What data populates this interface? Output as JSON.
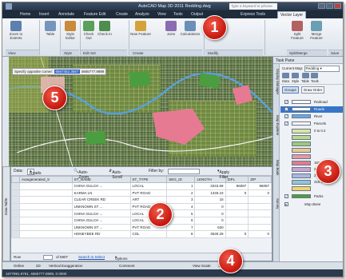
{
  "app": {
    "title": "AutoCAD Map 3D 2011    Redding.dwg",
    "search_placeholder": "Type a keyword or phrase"
  },
  "ribbon_tabs": [
    "Home",
    "Insert",
    "Annotate",
    "Feature Edit",
    "Create",
    "Analyze",
    "View",
    "Tools",
    "Output",
    "Express Tools",
    "Vector Layer"
  ],
  "ribbon": {
    "tools": [
      {
        "label": "Zoom to Extents",
        "color": "#5d7fb0"
      },
      {
        "label": "Table",
        "color": "#7794bd"
      },
      {
        "label": "Style Editor",
        "color": "#c98a3a"
      },
      {
        "label": "Check Out",
        "color": "#5aa05a"
      },
      {
        "label": "Check In",
        "color": "#4f8d4f"
      },
      {
        "label": "New Feature",
        "color": "#d3a23b"
      },
      {
        "label": "Joins",
        "color": "#8a6cb3"
      },
      {
        "label": "Calculations",
        "color": "#6b8fb9"
      },
      {
        "label": "Split Feature",
        "color": "#b36262"
      },
      {
        "label": "Merge Feature",
        "color": "#6a9fb3"
      }
    ],
    "groups": [
      "View",
      "Style",
      "Edit Set",
      "Create",
      "Modify",
      "Split/Merge",
      "Save"
    ]
  },
  "map": {
    "coord_label": "Specify opposite corner:",
    "coord_x": "6567452.3567",
    "coord_y": "4665777.8989"
  },
  "data_table": {
    "data_label": "Data:",
    "data_source": "Roads",
    "auto_zoom": "Auto-Zoom",
    "auto_scroll": "Auto-Scroll",
    "filter_by": "Filter by:",
    "apply_filter": "Apply Filter",
    "side_label": "Data Table",
    "columns": [
      "Autogenerated_S",
      "ST_NAME",
      "ST_TYPE",
      "SEG_ID",
      "LENGTH",
      "ZIPL",
      "ZIP"
    ],
    "rows": [
      [
        "",
        "CHINA GULCH ...",
        "LOCAL",
        "1",
        "3343.69",
        "96087",
        "96087"
      ],
      [
        "",
        "KARMA LN",
        "PVT ROAD",
        "2",
        "1349.23",
        "0",
        "0"
      ],
      [
        "",
        "CLEAR CREEK RD",
        "ART",
        "3",
        "15",
        "",
        ""
      ],
      [
        "",
        "UNKNOWN ST ...",
        "PVT ROAD",
        "4",
        "0",
        "",
        ""
      ],
      [
        "",
        "CHINA GULCH ...",
        "LOCAL",
        "5",
        "0",
        "",
        ""
      ],
      [
        "",
        "CHINA GULCH ...",
        "LOCAL",
        "6",
        "0",
        "",
        ""
      ],
      [
        "",
        "UNKNOWN ST ...",
        "PVT ROAD",
        "7",
        "630",
        "",
        ""
      ],
      [
        "",
        "HONEYBEE RD",
        "COL",
        "8",
        "3530.29",
        "0",
        "0"
      ]
    ],
    "footer_row_label": "Row",
    "footer_count": "of 5907",
    "footer_search": "Search to Select",
    "footer_options": "Options"
  },
  "status": {
    "tabs": [
      "Online",
      "2D",
      "Vertical Exaggeration",
      "Comment",
      "View Scale:",
      "1"
    ],
    "coords": "1677991.9761, 4665777.8989, 0.0000"
  },
  "taskpane": {
    "title": "Task Pane",
    "current_map_label": "Current Map:",
    "current_map": "Redding",
    "tools": [
      "Data",
      "Style",
      "Table",
      "Tools"
    ],
    "groups_btn": "Groups",
    "draw_order_btn": "Draw Order",
    "vertical_tabs": [
      "Display Manager",
      "Map Explorer",
      "Map Book",
      "Survey"
    ],
    "layers": [
      {
        "label": "Railroad",
        "checked": true,
        "swatch": "#ffffff",
        "selected": false
      },
      {
        "label": "Roads",
        "checked": true,
        "swatch": "#f9f9f9",
        "selected": true
      },
      {
        "label": "River",
        "checked": true,
        "swatch": "#6ea7e0",
        "selected": false
      },
      {
        "label": "Parcels",
        "checked": true,
        "swatch": "#ffffff",
        "selected": false
      }
    ],
    "parcel_themes": [
      {
        "label": "0 to 0.2",
        "color": "#d8e6a3"
      },
      {
        "label": "",
        "color": "#b9d88a"
      },
      {
        "label": "",
        "color": "#9bc97a"
      },
      {
        "label": "",
        "color": "#e7c98f"
      },
      {
        "label": "",
        "color": "#e39aa6"
      },
      {
        "label": "181 to 226",
        "color": "#e07c8e"
      },
      {
        "label": "226 to 271",
        "color": "#c9a2d6"
      },
      {
        "label": "271 to 316",
        "color": "#a8b8e0"
      },
      {
        "label": "316 to 362",
        "color": "#8fc6d9"
      },
      {
        "label": "",
        "color": "#f0d66a"
      }
    ],
    "parks_label": "Parks",
    "parks_color": "#4b9e3f",
    "map_base_label": "Map Base"
  },
  "callouts": [
    "1",
    "2",
    "3",
    "4",
    "5"
  ],
  "colors": {
    "callout_red": "#d2261a",
    "selection_blue": "#3775c9",
    "parcel_pink": "#e77a93",
    "parks_green": "#4b9e3f"
  }
}
